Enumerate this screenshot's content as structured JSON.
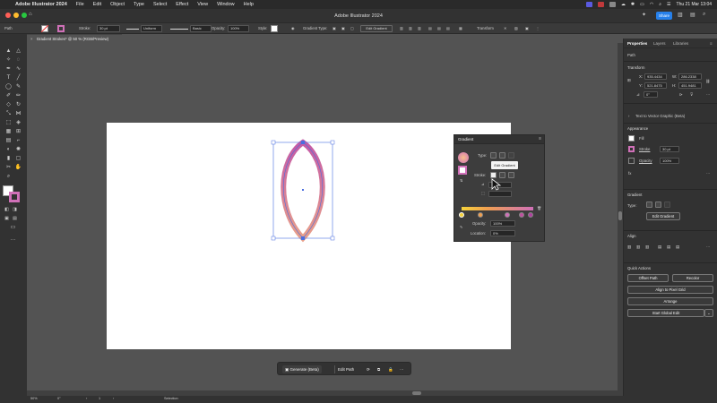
{
  "menubar": {
    "app_name": "Adobe Illustrator 2024",
    "items": [
      "File",
      "Edit",
      "Object",
      "Type",
      "Select",
      "Effect",
      "View",
      "Window",
      "Help"
    ],
    "clock": "Thu 21 Mar 13:04"
  },
  "titlebar": {
    "title": "Adobe Illustrator 2024",
    "share_label": "Share"
  },
  "controlbar": {
    "selection_label": "Path",
    "stroke_label": "Stroke:",
    "stroke_value": "30 pt",
    "profile_label": "Uniform",
    "brush_label": "Basic",
    "opacity_label": "Opacity:",
    "opacity_value": "100%",
    "style_label": "Style:",
    "gradient_type_label": "Gradient Type:",
    "edit_gradient_label": "Edit Gradient",
    "transform_label": "Transform"
  },
  "document": {
    "tab_label": "Gradient Strokes* @ 50 % (RGB/Preview)"
  },
  "gradient_panel": {
    "tab_label": "Gradient",
    "type_label": "Type:",
    "stroke_label": "Stroke:",
    "tooltip": "Edit Gradient",
    "opacity_label": "Opacity:",
    "opacity_value": "100%",
    "location_label": "Location:",
    "location_value": "0%"
  },
  "context_bar": {
    "generate_label": "Generate (Beta)",
    "edit_path_label": "Edit Path"
  },
  "properties_panel": {
    "tabs": [
      "Properties",
      "Layers",
      "Libraries"
    ],
    "selection": "Path",
    "transform_header": "Transform",
    "x_label": "X:",
    "x_value": "935.4434",
    "y_label": "Y:",
    "y_value": "521.8475",
    "w_label": "W:",
    "w_value": "286.2338",
    "h_label": "H:",
    "h_value": "451.9481",
    "angle_value": "0°",
    "text_to_vector": "Text to Vector Graphic (Beta)",
    "appearance_header": "Appearance",
    "fill_label": "Fill",
    "stroke_label": "Stroke",
    "stroke_value": "30 pt",
    "opacity_label": "Opacity",
    "opacity_value": "100%",
    "gradient_header": "Gradient",
    "gradient_type_label": "Type:",
    "edit_gradient_label": "Edit Gradient",
    "align_header": "Align",
    "quick_actions_header": "Quick Actions",
    "offset_path_label": "Offset Path",
    "recolor_label": "Recolor",
    "align_pixel_label": "Align to Pixel Grid",
    "arrange_label": "Arrange",
    "global_edit_label": "Start Global Edit"
  },
  "statusbar": {
    "zoom": "50%",
    "angle": "0°",
    "artboard": "1",
    "tool": "Selection"
  },
  "colors": {
    "gradient_start": "#c45aa6",
    "gradient_end": "#e8a08a",
    "selection_blue": "#4a6ee0",
    "accent": "#2680eb"
  }
}
